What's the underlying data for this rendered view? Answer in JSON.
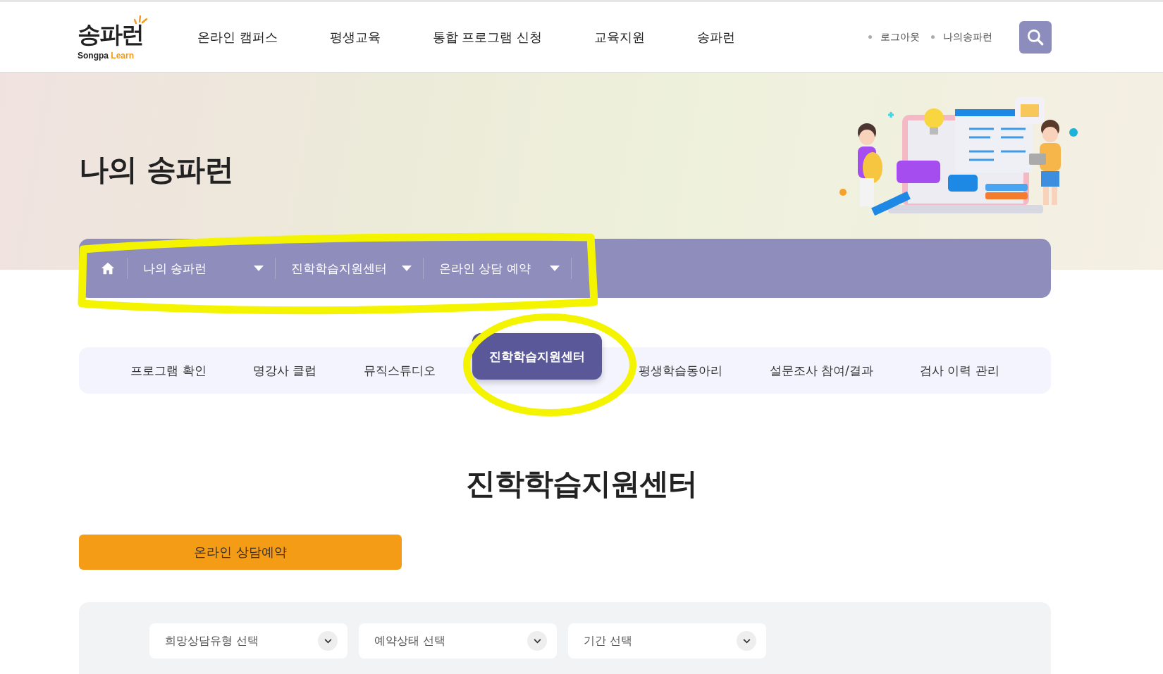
{
  "header": {
    "logo": {
      "korean": "송파런",
      "english_1": "Songpa",
      "english_2": "Learn"
    },
    "nav": [
      "온라인 캠퍼스",
      "평생교육",
      "통합 프로그램 신청",
      "교육지원",
      "송파런"
    ],
    "util_links": [
      "로그아웃",
      "나의송파런"
    ]
  },
  "hero": {
    "title": "나의 송파런"
  },
  "breadcrumb": [
    "나의 송파런",
    "진학학습지원센터",
    "온라인 상담 예약"
  ],
  "tabs": [
    {
      "label": "프로그램 확인",
      "selected": false
    },
    {
      "label": "명강사 클럽",
      "selected": false
    },
    {
      "label": "뮤직스튜디오",
      "selected": false
    },
    {
      "label": "진학학습지원센터",
      "selected": true
    },
    {
      "label": "평생학습동아리",
      "selected": false
    },
    {
      "label": "설문조사 참여/결과",
      "selected": false
    },
    {
      "label": "검사 이력 관리",
      "selected": false
    }
  ],
  "section_title": "진학학습지원센터",
  "sub_tab": "온라인 상담예약",
  "filters": [
    {
      "placeholder": "희망상담유형 선택"
    },
    {
      "placeholder": "예약상태 선택"
    },
    {
      "placeholder": "기간 선택"
    }
  ]
}
